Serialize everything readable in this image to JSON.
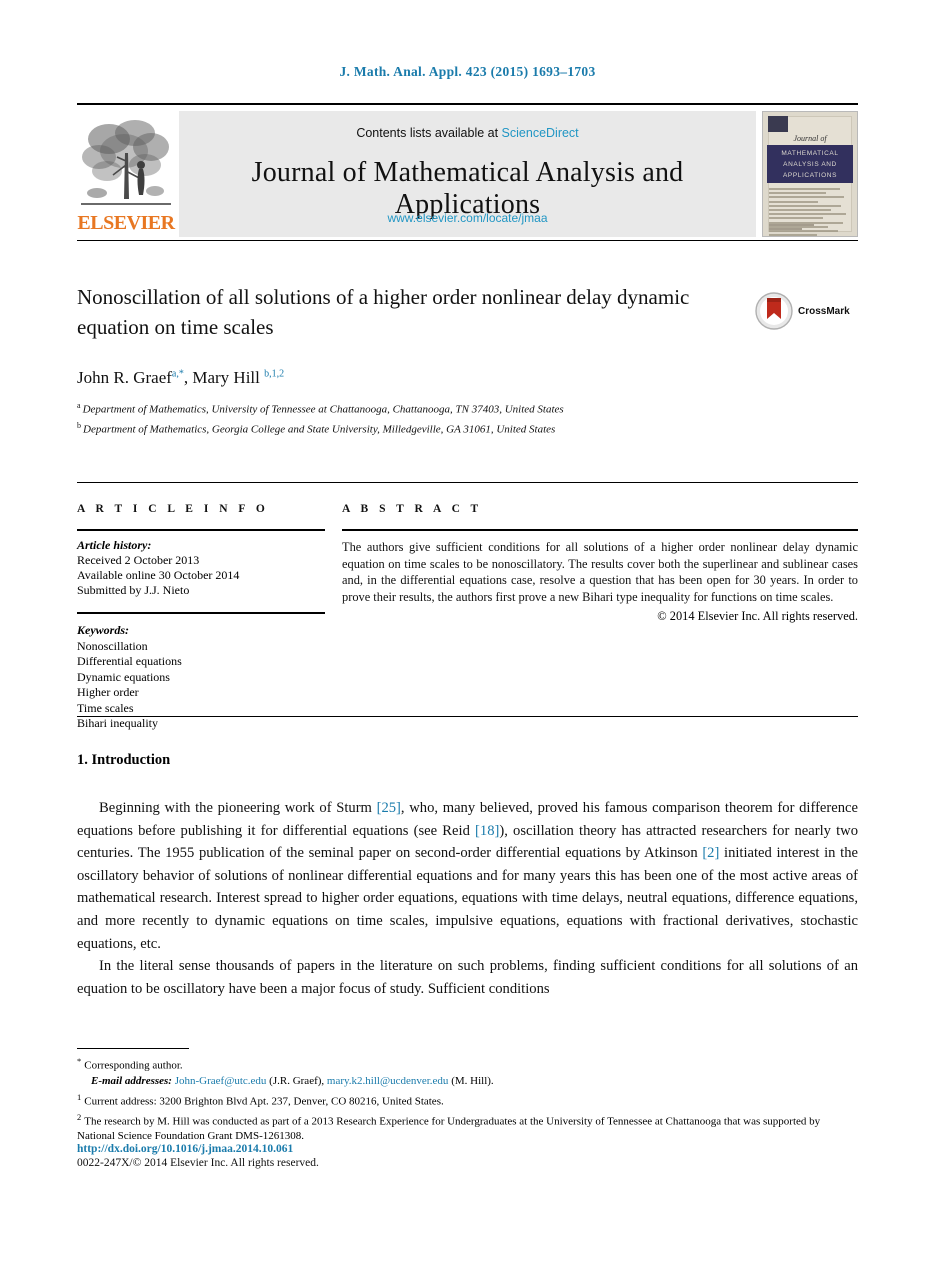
{
  "running_head": "J. Math. Anal. Appl. 423 (2015) 1693–1703",
  "masthead": {
    "publisher": "ELSEVIER",
    "contents_prefix": "Contents lists available at ",
    "contents_link": "ScienceDirect",
    "journal_title": "Journal of Mathematical Analysis and Applications",
    "journal_url": "www.elsevier.com/locate/jmaa",
    "cover": {
      "journal_of": "Journal of",
      "band_text": "MATHEMATICAL ANALYSIS AND APPLICATIONS"
    }
  },
  "article": {
    "title": "Nonoscillation of all solutions of a higher order nonlinear delay dynamic equation on time scales",
    "crossmark_label": "CrossMark",
    "authors_html": "John R. Graef<sup>a,*</sup>, Mary Hill <sup>b,1,2</sup>",
    "affiliation_a": "Department of Mathematics, University of Tennessee at Chattanooga, Chattanooga, TN 37403, United States",
    "affiliation_b": "Department of Mathematics, Georgia College and State University, Milledgeville, GA 31061, United States"
  },
  "info": {
    "heading": "A R T I C L E   I N F O",
    "history_label": "Article history:",
    "history": [
      "Received 2 October 2013",
      "Available online 30 October 2014",
      "Submitted by J.J. Nieto"
    ],
    "keywords_label": "Keywords:",
    "keywords": [
      "Nonoscillation",
      "Differential equations",
      "Dynamic equations",
      "Higher order",
      "Time scales",
      "Bihari inequality"
    ]
  },
  "abstract": {
    "heading": "A B S T R A C T",
    "text": "The authors give sufficient conditions for all solutions of a higher order nonlinear delay dynamic equation on time scales to be nonoscillatory. The results cover both the superlinear and sublinear cases and, in the differential equations case, resolve a question that has been open for 30 years. In order to prove their results, the authors first prove a new Bihari type inequality for functions on time scales.",
    "copyright": "© 2014 Elsevier Inc. All rights reserved."
  },
  "body": {
    "section_title": "1. Introduction",
    "paragraph_1_parts": {
      "p1": "Beginning with the pioneering work of Sturm ",
      "r1": "[25]",
      "p2": ", who, many believed, proved his famous comparison theorem for difference equations before publishing it for differential equations (see Reid ",
      "r2": "[18]",
      "p3": "), oscillation theory has attracted researchers for nearly two centuries. The 1955 publication of the seminal paper on second-order differential equations by Atkinson ",
      "r3": "[2]",
      "p4": " initiated interest in the oscillatory behavior of solutions of nonlinear differential equations and for many years this has been one of the most active areas of mathematical research. Interest spread to higher order equations, equations with time delays, neutral equations, difference equations, and more recently to dynamic equations on time scales, impulsive equations, equations with fractional derivatives, stochastic equations, etc."
    },
    "paragraph_2": "In the literal sense thousands of papers in the literature on such problems, finding sufficient conditions for all solutions of an equation to be oscillatory have been a major focus of study. Sufficient conditions"
  },
  "footnotes": {
    "corresponding": "Corresponding author.",
    "email_label": "E-mail addresses:",
    "email_1": "John-Graef@utc.edu",
    "email_1_owner": "(J.R. Graef),",
    "email_2": "mary.k2.hill@ucdenver.edu",
    "email_2_owner": "(M. Hill).",
    "note_1": "Current address: 3200 Brighton Blvd Apt. 237, Denver, CO 80216, United States.",
    "note_2": "The research by M. Hill was conducted as part of a 2013 Research Experience for Undergraduates at the University of Tennessee at Chattanooga that was supported by National Science Foundation Grant DMS-1261308."
  },
  "footer": {
    "doi": "http://dx.doi.org/10.1016/j.jmaa.2014.10.061",
    "issn_line": "0022-247X/© 2014 Elsevier Inc. All rights reserved."
  },
  "colors": {
    "link_blue": "#1a7bab",
    "science_direct": "#2196c4",
    "elsevier_orange": "#e87722",
    "cover_band": "#32305e"
  }
}
